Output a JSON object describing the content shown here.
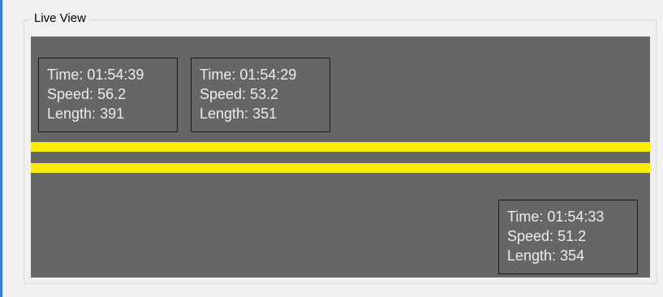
{
  "group": {
    "title": "Live View"
  },
  "labels": {
    "time": "Time:",
    "speed": "Speed:",
    "length": "Length:"
  },
  "vehicles": [
    {
      "time": "01:54:39",
      "speed": "56.2",
      "length": "391"
    },
    {
      "time": "01:54:29",
      "speed": "53.2",
      "length": "351"
    },
    {
      "time": "01:54:33",
      "speed": "51.2",
      "length": "354"
    }
  ],
  "colors": {
    "road": "#666666",
    "lane_line": "#ffeb0a",
    "overlay_text": "#ececec"
  }
}
